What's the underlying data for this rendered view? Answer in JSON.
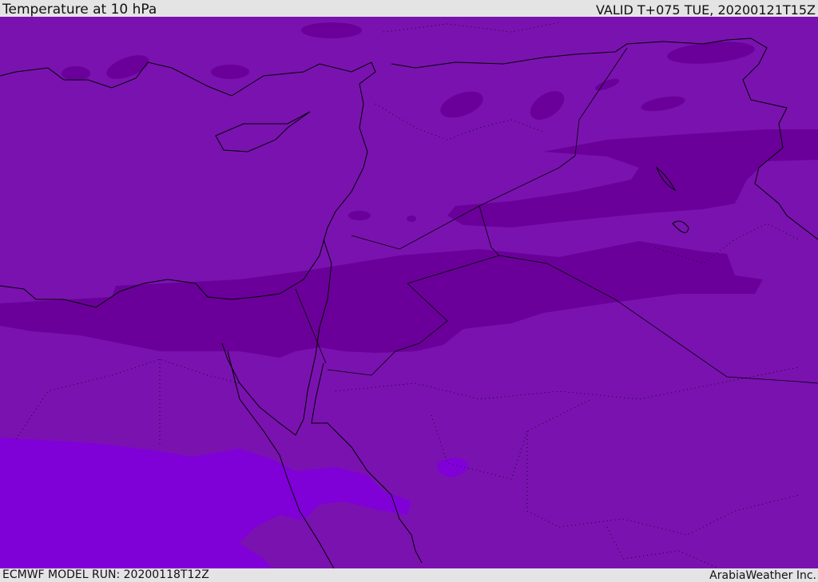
{
  "header": {
    "title": "Temperature at 10 hPa",
    "valid_time": "VALID T+075 TUE, 20200121T15Z"
  },
  "footer": {
    "model_run": "ECMWF MODEL RUN: 20200118T12Z",
    "credit": "ArabiaWeather Inc."
  },
  "colors": {
    "base": "#7a12b0",
    "cold_band": "#6a0099",
    "warm_region": "#8000d8",
    "coastline": "#000000",
    "background": "#e4e4e4"
  }
}
